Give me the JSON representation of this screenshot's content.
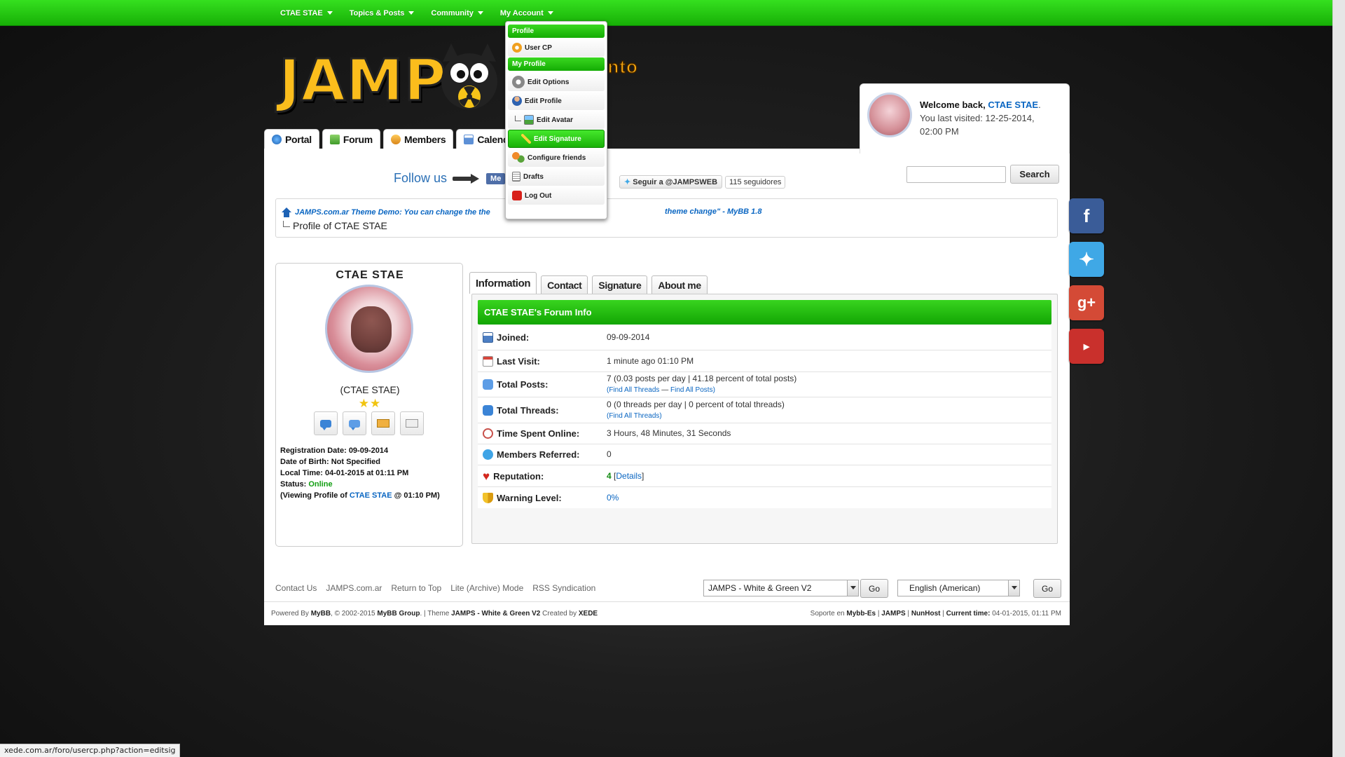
{
  "topnav": [
    {
      "label": "CTAE STAE"
    },
    {
      "label": "Topics & Posts"
    },
    {
      "label": "Community"
    },
    {
      "label": "My Account"
    }
  ],
  "logo": {
    "text": "JAMPS",
    "slogan": "ento"
  },
  "maintabs": [
    {
      "label": "Portal"
    },
    {
      "label": "Forum"
    },
    {
      "label": "Members"
    },
    {
      "label": "Calendar"
    }
  ],
  "welcome": {
    "greeting": "Welcome back,",
    "username": "CTAE STAE",
    "punct": ".",
    "last_visited_label": "You last visited:",
    "last_visited_date": "12-25-2014,",
    "last_visited_time": "02:00 PM"
  },
  "follow": {
    "label": "Follow us",
    "fb_like": "Me",
    "twitter_button": "Seguir a @JAMPSWEB",
    "twitter_count": "115 seguidores"
  },
  "search": {
    "button": "Search",
    "placeholder": ""
  },
  "breadcrumb": {
    "site_link": "JAMPS.com.ar Theme Demo: You can change the the",
    "site_link_tail": "theme change\" - MyBB 1.8",
    "current": "Profile of CTAE STAE"
  },
  "profile": {
    "name": "CTAE STAE",
    "usertitle": "(CTAE STAE)",
    "stars": "★★",
    "registration_label": "Registration Date:",
    "registration_date": "09-09-2014",
    "dob_label": "Date of Birth:",
    "dob": "Not Specified",
    "local_time_label": "Local Time:",
    "local_time": "04-01-2015 at 01:11 PM",
    "status_label": "Status:",
    "status": "Online",
    "viewing_prefix": "(Viewing Profile of",
    "viewing_name": "CTAE STAE",
    "viewing_suffix": "@ 01:10 PM)"
  },
  "profile_tabs": [
    {
      "label": "Information"
    },
    {
      "label": "Contact"
    },
    {
      "label": "Signature"
    },
    {
      "label": "About me"
    }
  ],
  "forum_info": {
    "title": "CTAE STAE's Forum Info",
    "rows": [
      {
        "label": "Joined:",
        "value": "09-09-2014"
      },
      {
        "label": "Last Visit:",
        "value": "1 minute ago 01:10 PM"
      },
      {
        "label": "Total Posts:",
        "value": "7 (0.03 posts per day | 41.18 percent of total posts)",
        "link1": "Find All Threads",
        "sep": "—",
        "link2": "Find All Posts"
      },
      {
        "label": "Total Threads:",
        "value": "0 (0 threads per day | 0 percent of total threads)",
        "link1": "Find All Threads"
      },
      {
        "label": "Time Spent Online:",
        "value": "3 Hours, 48 Minutes, 31 Seconds"
      },
      {
        "label": "Members Referred:",
        "value": "0"
      },
      {
        "label": "Reputation:",
        "value": "4",
        "link1": "Details"
      },
      {
        "label": "Warning Level:",
        "value": "0%"
      }
    ]
  },
  "footer": {
    "links": [
      "Contact Us",
      "JAMPS.com.ar",
      "Return to Top",
      "Lite (Archive) Mode",
      "RSS Syndication"
    ],
    "theme_select": "JAMPS - White & Green V2",
    "lang_select": "English (American)",
    "go": "Go",
    "powered_prefix": "Powered By",
    "mybb": "MyBB",
    "copyright_mid": ", © 2002-2015",
    "mybb_group": "MyBB Group",
    "theme_text": ". | Theme",
    "theme_name": "JAMPS - White & Green V2",
    "created_by": "Created by",
    "author": "XEDE",
    "soporte": "Soporte en",
    "mybb_es": "Mybb-Es",
    "jamps": "JAMPS",
    "nunhost": "NunHost",
    "current_time_label": "Current time:",
    "current_time": "04-01-2015, 01:11 PM"
  },
  "dropdown": {
    "header_profile": "Profile",
    "user_cp": "User CP",
    "header_my_profile": "My Profile",
    "edit_options": "Edit Options",
    "edit_profile": "Edit Profile",
    "edit_avatar": "Edit Avatar",
    "edit_signature": "Edit Signature",
    "configure_friends": "Configure friends",
    "drafts": "Drafts",
    "log_out": "Log Out"
  },
  "statusbar": "xede.com.ar/foro/usercp.php?action=editsig",
  "colors": {
    "accent_green": "#17b006",
    "link_blue": "#0a66c2"
  }
}
